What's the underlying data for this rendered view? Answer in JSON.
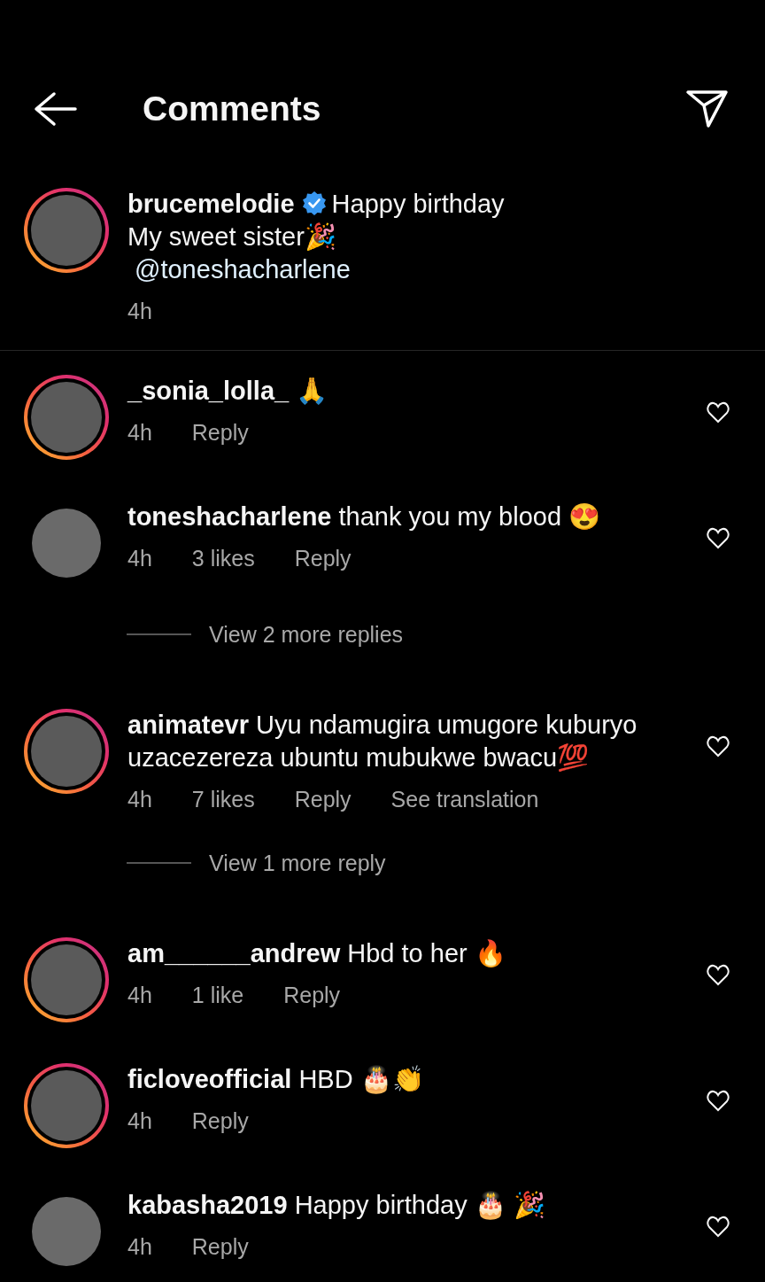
{
  "header": {
    "title": "Comments"
  },
  "caption": {
    "username": "brucemelodie",
    "verified": true,
    "story_ring": true,
    "text": "Happy birthday\nMy sweet sister🎉",
    "mention": "@toneshacharlene",
    "time": "4h"
  },
  "items": [
    {
      "kind": "comment",
      "username": "_sonia_lolla_",
      "text": "🙏",
      "story_ring": true,
      "liked": false,
      "meta": [
        "4h",
        "Reply"
      ]
    },
    {
      "kind": "comment",
      "username": "toneshacharlene",
      "text": "thank you my blood 😍",
      "story_ring": false,
      "liked": false,
      "meta": [
        "4h",
        "3 likes",
        "Reply"
      ]
    },
    {
      "kind": "replies",
      "text": "View 2 more replies"
    },
    {
      "kind": "comment",
      "username": "animatevr",
      "text": "Uyu ndamugira umugore kuburyo uzacezereza ubuntu mubukwe bwacu💯",
      "story_ring": true,
      "liked": false,
      "meta": [
        "4h",
        "7 likes",
        "Reply",
        "See translation"
      ]
    },
    {
      "kind": "replies",
      "text": "View 1 more reply"
    },
    {
      "kind": "comment",
      "username": "am______andrew",
      "text": "Hbd to her 🔥",
      "story_ring": true,
      "liked": false,
      "meta": [
        "4h",
        "1 like",
        "Reply"
      ]
    },
    {
      "kind": "comment",
      "username": "ficloveofficial",
      "text": "HBD 🎂👏",
      "story_ring": true,
      "liked": false,
      "meta": [
        "4h",
        "Reply"
      ]
    },
    {
      "kind": "comment",
      "username": "kabasha2019",
      "text": "Happy birthday 🎂 🎉",
      "story_ring": false,
      "liked": false,
      "meta": [
        "4h",
        "Reply"
      ]
    }
  ]
}
